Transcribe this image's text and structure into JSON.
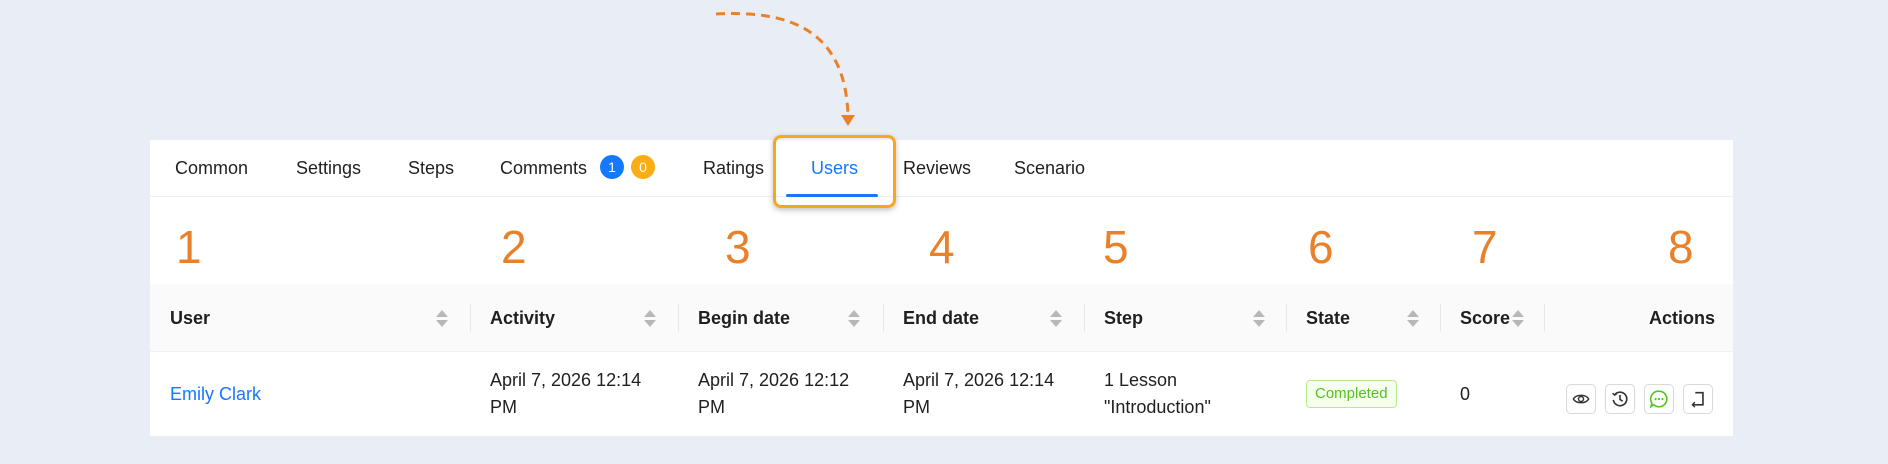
{
  "tabs": [
    {
      "label": "Common"
    },
    {
      "label": "Settings"
    },
    {
      "label": "Steps"
    },
    {
      "label": "Comments",
      "badges": [
        "1",
        "0"
      ]
    },
    {
      "label": "Ratings"
    },
    {
      "label": "Users",
      "active": true
    },
    {
      "label": "Reviews"
    },
    {
      "label": "Scenario"
    }
  ],
  "colors": {
    "accent": "#1677ff",
    "badge_blue": "#1677ff",
    "badge_orange": "#faad14",
    "highlight": "#f5a623",
    "annotation": "#e8812a",
    "tag_green": "#52c41a"
  },
  "column_numbers": [
    "1",
    "2",
    "3",
    "4",
    "5",
    "6",
    "7",
    "8"
  ],
  "table": {
    "columns": [
      "User",
      "Activity",
      "Begin date",
      "End date",
      "Step",
      "State",
      "Score",
      "Actions"
    ],
    "rows": [
      {
        "user": "Emily Clark",
        "activity": "April 7, 2026 12:14 PM",
        "begin": "April 7, 2026 12:12 PM",
        "end": "April 7, 2026 12:14 PM",
        "step": "1 Lesson \"Introduction\"",
        "state": "Completed",
        "score": "0"
      }
    ]
  },
  "actions": [
    {
      "icon": "eye-icon"
    },
    {
      "icon": "history-icon"
    },
    {
      "icon": "comment-icon"
    },
    {
      "icon": "return-icon"
    }
  ]
}
